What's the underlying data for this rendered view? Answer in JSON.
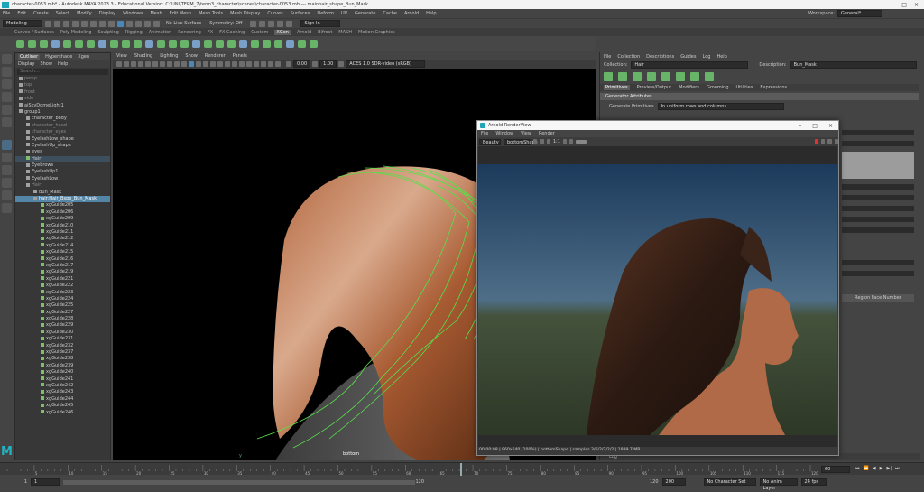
{
  "window": {
    "title": "character-0053.mb* - Autodesk MAYA 2023.3 - Educational Version: C:\\UNI\\TERM_7\\term3_character\\scenes\\character-0053.mb  ---  mainhair_shape_Bun_Mask",
    "workspace_label": "Workspace:",
    "workspace_value": "General*"
  },
  "menus": [
    "File",
    "Edit",
    "Create",
    "Select",
    "Modify",
    "Display",
    "Windows",
    "Mesh",
    "Edit Mesh",
    "Mesh Tools",
    "Mesh Display",
    "Curves",
    "Surfaces",
    "Deform",
    "UV",
    "Generate",
    "Cache",
    "Arnold",
    "Help"
  ],
  "status": {
    "mode": "Modeling",
    "live_surface": "No Live Surface",
    "symmetry": "Symmetry: Off",
    "sign_in": "Sign In"
  },
  "shelf_tabs": [
    "Curves / Surfaces",
    "Poly Modeling",
    "Sculpting",
    "Rigging",
    "Animation",
    "Rendering",
    "FX",
    "FX Caching",
    "Custom",
    "XGen",
    "Arnold",
    "Bifrost",
    "MASH",
    "Motion Graphics"
  ],
  "shelf_active": "XGen",
  "outliner": {
    "tabs": [
      "Outliner",
      "Hypershade",
      "Xgen"
    ],
    "menu": [
      "Display",
      "Show",
      "Help"
    ],
    "search_placeholder": "Search...",
    "rows": [
      {
        "label": "persp",
        "dim": true
      },
      {
        "label": "top",
        "dim": true
      },
      {
        "label": "front",
        "dim": true
      },
      {
        "label": "side",
        "dim": true
      },
      {
        "label": "aiSkyDomeLight1",
        "dim": false
      },
      {
        "label": "group1",
        "dim": false
      },
      {
        "label": "character_body",
        "dim": false
      },
      {
        "label": "character_head",
        "dim": true
      },
      {
        "label": "character_eyes",
        "dim": true
      },
      {
        "label": "EyelashLow_shape",
        "dim": false
      },
      {
        "label": "EyelashUp_shape",
        "dim": false
      },
      {
        "label": "eyes",
        "dim": false
      },
      {
        "label": "Hair",
        "dim": false,
        "hl": true
      },
      {
        "label": "Eyebrows",
        "dim": false
      },
      {
        "label": "EyelashUp1",
        "dim": false
      },
      {
        "label": "EyelashLow",
        "dim": false
      },
      {
        "label": "Hair",
        "dim": true
      },
      {
        "label": "Bun_Mask",
        "dim": false
      },
      {
        "label": "hair:Hair_Bspe_Bun_Mask",
        "dim": false,
        "sel": true
      },
      {
        "label": "xgGuide205",
        "dim": false
      },
      {
        "label": "xgGuide206",
        "dim": false
      },
      {
        "label": "xgGuide209",
        "dim": false
      },
      {
        "label": "xgGuide210",
        "dim": false
      },
      {
        "label": "xgGuide211",
        "dim": false
      },
      {
        "label": "xgGuide212",
        "dim": false
      },
      {
        "label": "xgGuide214",
        "dim": false
      },
      {
        "label": "xgGuide215",
        "dim": false
      },
      {
        "label": "xgGuide216",
        "dim": false
      },
      {
        "label": "xgGuide217",
        "dim": false
      },
      {
        "label": "xgGuide219",
        "dim": false
      },
      {
        "label": "xgGuide221",
        "dim": false
      },
      {
        "label": "xgGuide222",
        "dim": false
      },
      {
        "label": "xgGuide223",
        "dim": false
      },
      {
        "label": "xgGuide224",
        "dim": false
      },
      {
        "label": "xgGuide225",
        "dim": false
      },
      {
        "label": "xgGuide227",
        "dim": false
      },
      {
        "label": "xgGuide228",
        "dim": false
      },
      {
        "label": "xgGuide229",
        "dim": false
      },
      {
        "label": "xgGuide230",
        "dim": false
      },
      {
        "label": "xgGuide231",
        "dim": false
      },
      {
        "label": "xgGuide232",
        "dim": false
      },
      {
        "label": "xgGuide237",
        "dim": false
      },
      {
        "label": "xgGuide238",
        "dim": false
      },
      {
        "label": "xgGuide239",
        "dim": false
      },
      {
        "label": "xgGuide240",
        "dim": false
      },
      {
        "label": "xgGuide241",
        "dim": false
      },
      {
        "label": "xgGuide242",
        "dim": false
      },
      {
        "label": "xgGuide243",
        "dim": false
      },
      {
        "label": "xgGuide244",
        "dim": false
      },
      {
        "label": "xgGuide245",
        "dim": false
      },
      {
        "label": "xgGuide246",
        "dim": false
      }
    ]
  },
  "viewport": {
    "menu": [
      "View",
      "Shading",
      "Lighting",
      "Show",
      "Renderer",
      "Panels"
    ],
    "field_1": "0.00",
    "field_2": "1.00",
    "colorspace": "ACES 1.0 SDR-video (sRGB)",
    "camera_label": "bottom"
  },
  "xgen": {
    "menu": [
      "File",
      "Collection",
      "Descriptions",
      "Guides",
      "Log",
      "Help"
    ],
    "collection_label": "Collection:",
    "collection_value": "Hair",
    "description_label": "Description:",
    "description_value": "Bun_Mask",
    "tabs": [
      "Primitives",
      "Preview/Output",
      "Modifiers",
      "Grooming",
      "Utilities",
      "Expressions"
    ],
    "section_header": "Generator Attributes",
    "generate_label": "Generate Primitives",
    "generate_value": "In uniform rows and columns",
    "right_button": "Region Face Number",
    "log_label": "Log"
  },
  "renderview": {
    "title": "Arnold RenderView",
    "menu": [
      "File",
      "Window",
      "View",
      "Render"
    ],
    "aov": "Beauty",
    "camera": "bottomShape",
    "zoom": "1:1",
    "status": "00:00:08 | 960x540 (100%) | bottomShape | samples 3/6/2/2/2/2 | 1839.7 MB"
  },
  "timeline": {
    "ticks": [
      "5",
      "10",
      "15",
      "20",
      "25",
      "30",
      "35",
      "40",
      "45",
      "50",
      "55",
      "60",
      "65",
      "70",
      "75",
      "80",
      "85",
      "90",
      "95",
      "100",
      "105",
      "110",
      "115",
      "120"
    ],
    "current_frame": "60"
  },
  "range": {
    "start": "1",
    "start2": "1",
    "mid": "120",
    "end": "120",
    "end2": "200",
    "character_set": "No Character Set",
    "anim_layer": "No Anim Layer",
    "fps": "24 fps"
  }
}
